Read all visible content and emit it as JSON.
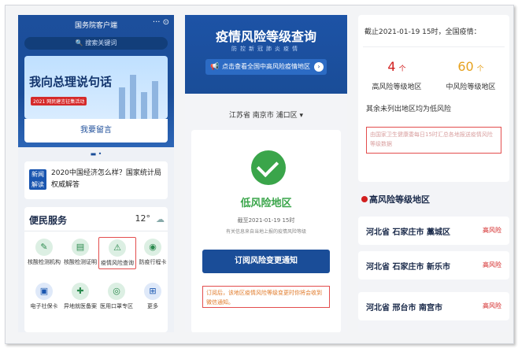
{
  "app": {
    "title": "国务院客户端",
    "controls": "··· ⊙"
  },
  "left": {
    "search_placeholder": "搜索关键词",
    "banner_slogan": "我向总理说句话",
    "banner_year": "2021",
    "banner_sub": "网民建言征集活动",
    "leave_message": "我要留言",
    "news_tag": "新闻解读",
    "news_text": "2020中国经济怎么样？国家统计局权威解答",
    "services_title": "便民服务",
    "temperature": "12°",
    "services": [
      {
        "label": "核酸检测机构",
        "icon": "test-tube-icon"
      },
      {
        "label": "核酸检测证明",
        "icon": "certificate-icon"
      },
      {
        "label": "疫情风险查询",
        "icon": "warning-icon"
      },
      {
        "label": "防疫行程卡",
        "icon": "location-pin-icon"
      },
      {
        "label": "电子社保卡",
        "icon": "social-card-icon"
      },
      {
        "label": "异地就医备案",
        "icon": "medical-icon"
      },
      {
        "label": "医用口罩专区",
        "icon": "mask-icon"
      },
      {
        "label": "更多",
        "icon": "more-grid-icon"
      }
    ]
  },
  "middle": {
    "title": "疫情风险等级查询",
    "subtitle": "防控新冠肺炎疫情",
    "banner_text": "点击查看全国中高风险疫情地区",
    "location": "江苏省 南京市 浦口区 ▾",
    "risk_level": "低风险地区",
    "cutoff": "截至2021-01-19 15时",
    "note": "有关信息来自当地上报的疫情风险等级",
    "subscribe_button": "订阅风险变更通知",
    "hint": "订阅后，该地区疫情风险等级变更时你将会收到微信通知。"
  },
  "right": {
    "header": "截止2021-01-19 15时，全国疫情：",
    "high_count": "4",
    "high_unit": "个",
    "high_label": "高风险等级地区",
    "mid_count": "60",
    "mid_unit": "个",
    "mid_label": "中风险等级地区",
    "low_text": "其余未列出地区均为低风险",
    "source": "由国家卫生健康委每日15时汇总各地报送疫情风险等级数据",
    "high_risk_title": "高风险等级地区",
    "areas": [
      {
        "name": "河北省 石家庄市 藁城区",
        "level": "高风险"
      },
      {
        "name": "河北省 石家庄市 新乐市",
        "level": "高风险"
      },
      {
        "name": "河北省 邢台市 南宫市",
        "level": "高风险"
      }
    ],
    "colors": {
      "high": "#d21f1f",
      "mid": "#e6a11d",
      "low": "#3aa54a"
    }
  }
}
